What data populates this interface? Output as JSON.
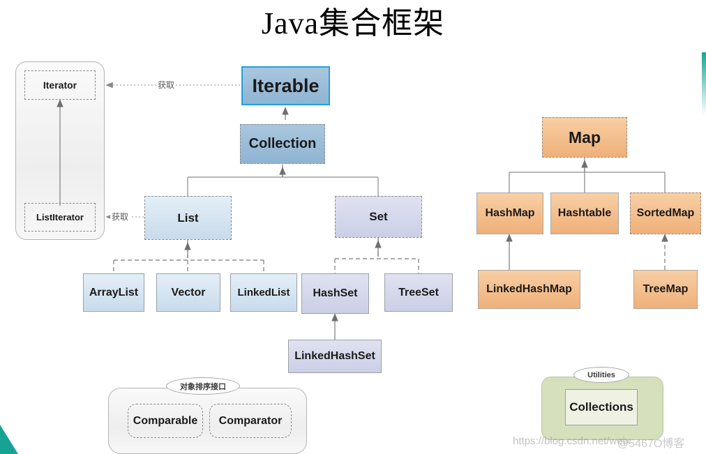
{
  "title": "Java集合框架",
  "iterator_group": {
    "iterator_label": "Iterator",
    "listiterator_label": "ListIterator"
  },
  "core": {
    "iterable": "Iterable",
    "collection": "Collection",
    "list": "List",
    "set": "Set"
  },
  "list_impls": [
    {
      "label": "ArrayList"
    },
    {
      "label": "Vector"
    },
    {
      "label": "LinkedList"
    }
  ],
  "set_impls": [
    {
      "label": "HashSet"
    },
    {
      "label": "TreeSet"
    }
  ],
  "set_sub": {
    "linkedhashset": "LinkedHashSet"
  },
  "map_branch": {
    "map": "Map",
    "hashmap": "HashMap",
    "hashtable": "Hashtable",
    "sortedmap": "SortedMap",
    "linkedhashmap": "LinkedHashMap",
    "treemap": "TreeMap"
  },
  "compare_group": {
    "group_label": "对象排序接口",
    "comparable": "Comparable",
    "comparator": "Comparator"
  },
  "utilities_group": {
    "group_label": "Utilities",
    "collections": "Collections"
  },
  "edge_labels": {
    "iterable_get": "获取",
    "list_get": "获取"
  },
  "watermark": {
    "url": "https://blog.csdn.net/weix",
    "suffix": "@5467O博客"
  },
  "colors": {
    "blue_dark": "#8fb4d2",
    "blue_light": "#c8dbeb",
    "lavender": "#cbcfe6",
    "orange": "#efb079",
    "green": "#d7e0bd",
    "accent_selected": "#1fa2e0",
    "teal": "#16a394",
    "line": "#8d8d8d"
  }
}
